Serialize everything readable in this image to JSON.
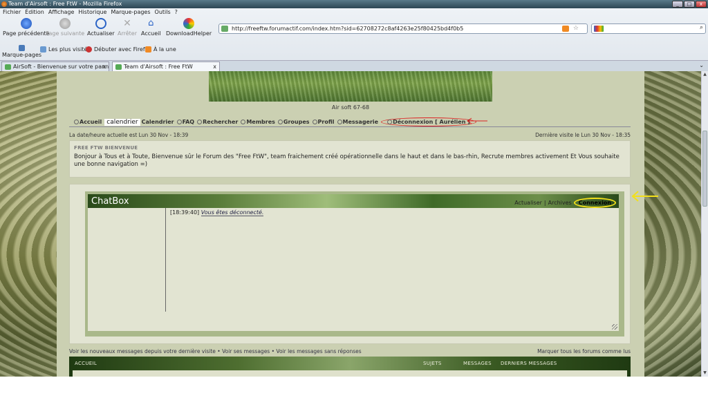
{
  "window": {
    "title": "Team d'Airsoft : Free FtW - Mozilla Firefox",
    "buttons": [
      "_",
      "□",
      "x"
    ]
  },
  "menubar": [
    "Fichier",
    "Édition",
    "Affichage",
    "Historique",
    "Marque-pages",
    "Outils",
    "?"
  ],
  "nav": {
    "back": "Page précédente",
    "forward": "Page suivante",
    "reload": "Actualiser",
    "stop": "Arrêter",
    "home": "Accueil",
    "download": "DownloadHelper",
    "url": "http://freeftw.forumactif.com/index.htm?sid=62708272c8af4263e25f80425bd4f0b5"
  },
  "bookmarks": {
    "marque_pages": "Marque-pages",
    "items": [
      "Les plus visités",
      "Débuter avec Firefox",
      "À la une"
    ]
  },
  "tabs": [
    {
      "label": "AirSoft - Bienvenue sur votre panne...",
      "close": "x"
    },
    {
      "label": "Team d'Airsoft : Free FtW",
      "close": "x"
    }
  ],
  "page": {
    "banner_caption": "Air soft 67-68",
    "menu": {
      "accueil": "Accueil",
      "calendrier_highlight": "calendrier",
      "calendrier": "Calendrier",
      "faq": "FAQ",
      "rechercher": "Rechercher",
      "membres": "Membres",
      "groupes": "Groupes",
      "profil": "Profil",
      "messagerie": "Messagerie",
      "deconnexion": "Déconnexion [ Aurélien ]"
    },
    "date_now": "La date/heure actuelle est Lun 30 Nov - 18:39",
    "last_visit": "Dernière visite le Lun 30 Nov - 18:35",
    "welcome_heading": "FREE FTW BIENVENUE",
    "welcome_text": "Bonjour à Tous et à Toute, Bienvenue sûr le Forum des \"Free FtW\", team fraichement créé opérationnelle dans le haut et dans le bas-rhin, Recrute membres activement Et Vous souhaite une bonne navigation =)",
    "chatbox": {
      "title": "ChatBox",
      "actualiser": "Actualiser",
      "sep": "|",
      "archives": "Archives",
      "connexion": "Connexion",
      "msg_time": "[18:39:40]",
      "msg_text": "Vous êtes déconnecté."
    },
    "links": {
      "left": "Voir les nouveaux messages depuis votre dernière visite • Voir ses messages • Voir les messages sans réponses",
      "right": "Marquer tous les forums comme lus"
    },
    "forum_head": {
      "accueil": "ACCUEIL",
      "sujets": "SUJETS",
      "messages": "MESSAGES",
      "derniers": "DERNIERS MESSAGES"
    }
  },
  "colors": {
    "page_bg": "#cbd0b2",
    "panel_bg": "#e2e4d2",
    "annotation_red": "#dd2222",
    "annotation_yellow": "#f3e01a"
  }
}
